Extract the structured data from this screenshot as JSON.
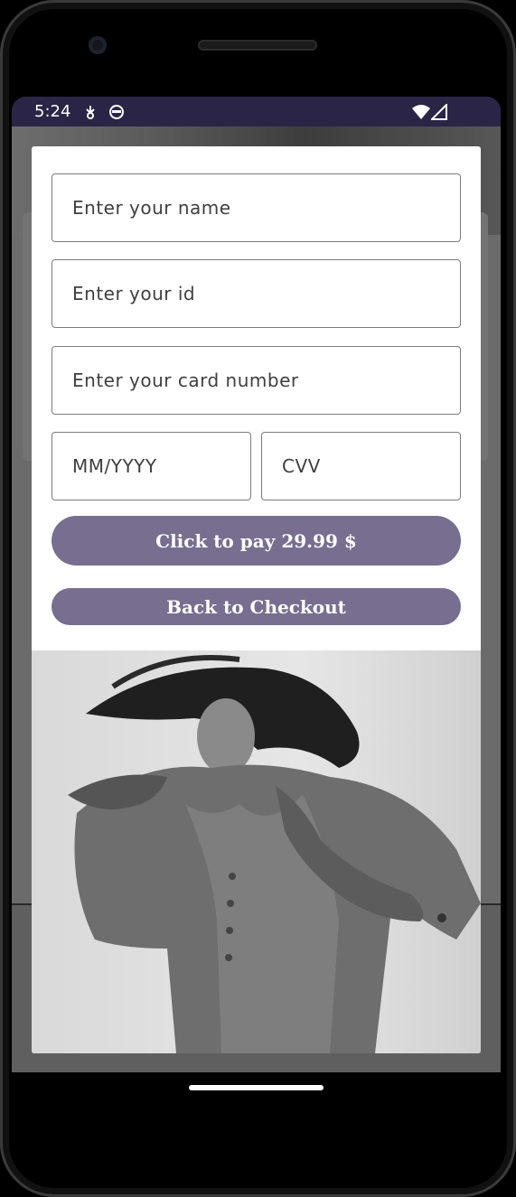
{
  "status_bar": {
    "time": "5:24",
    "icons": [
      "usb-debug-icon",
      "face-icon",
      "wifi-icon",
      "signal-icon"
    ]
  },
  "form": {
    "name_placeholder": "Enter your name",
    "id_placeholder": "Enter your id",
    "card_placeholder": "Enter your card number",
    "expiry_placeholder": "MM/YYYY",
    "cvv_placeholder": "CVV"
  },
  "buttons": {
    "pay_label": "Click to pay 29.99 $",
    "back_label": "Back to Checkout"
  },
  "colors": {
    "accent": "#776e90",
    "status_bar": "#2a2547"
  }
}
